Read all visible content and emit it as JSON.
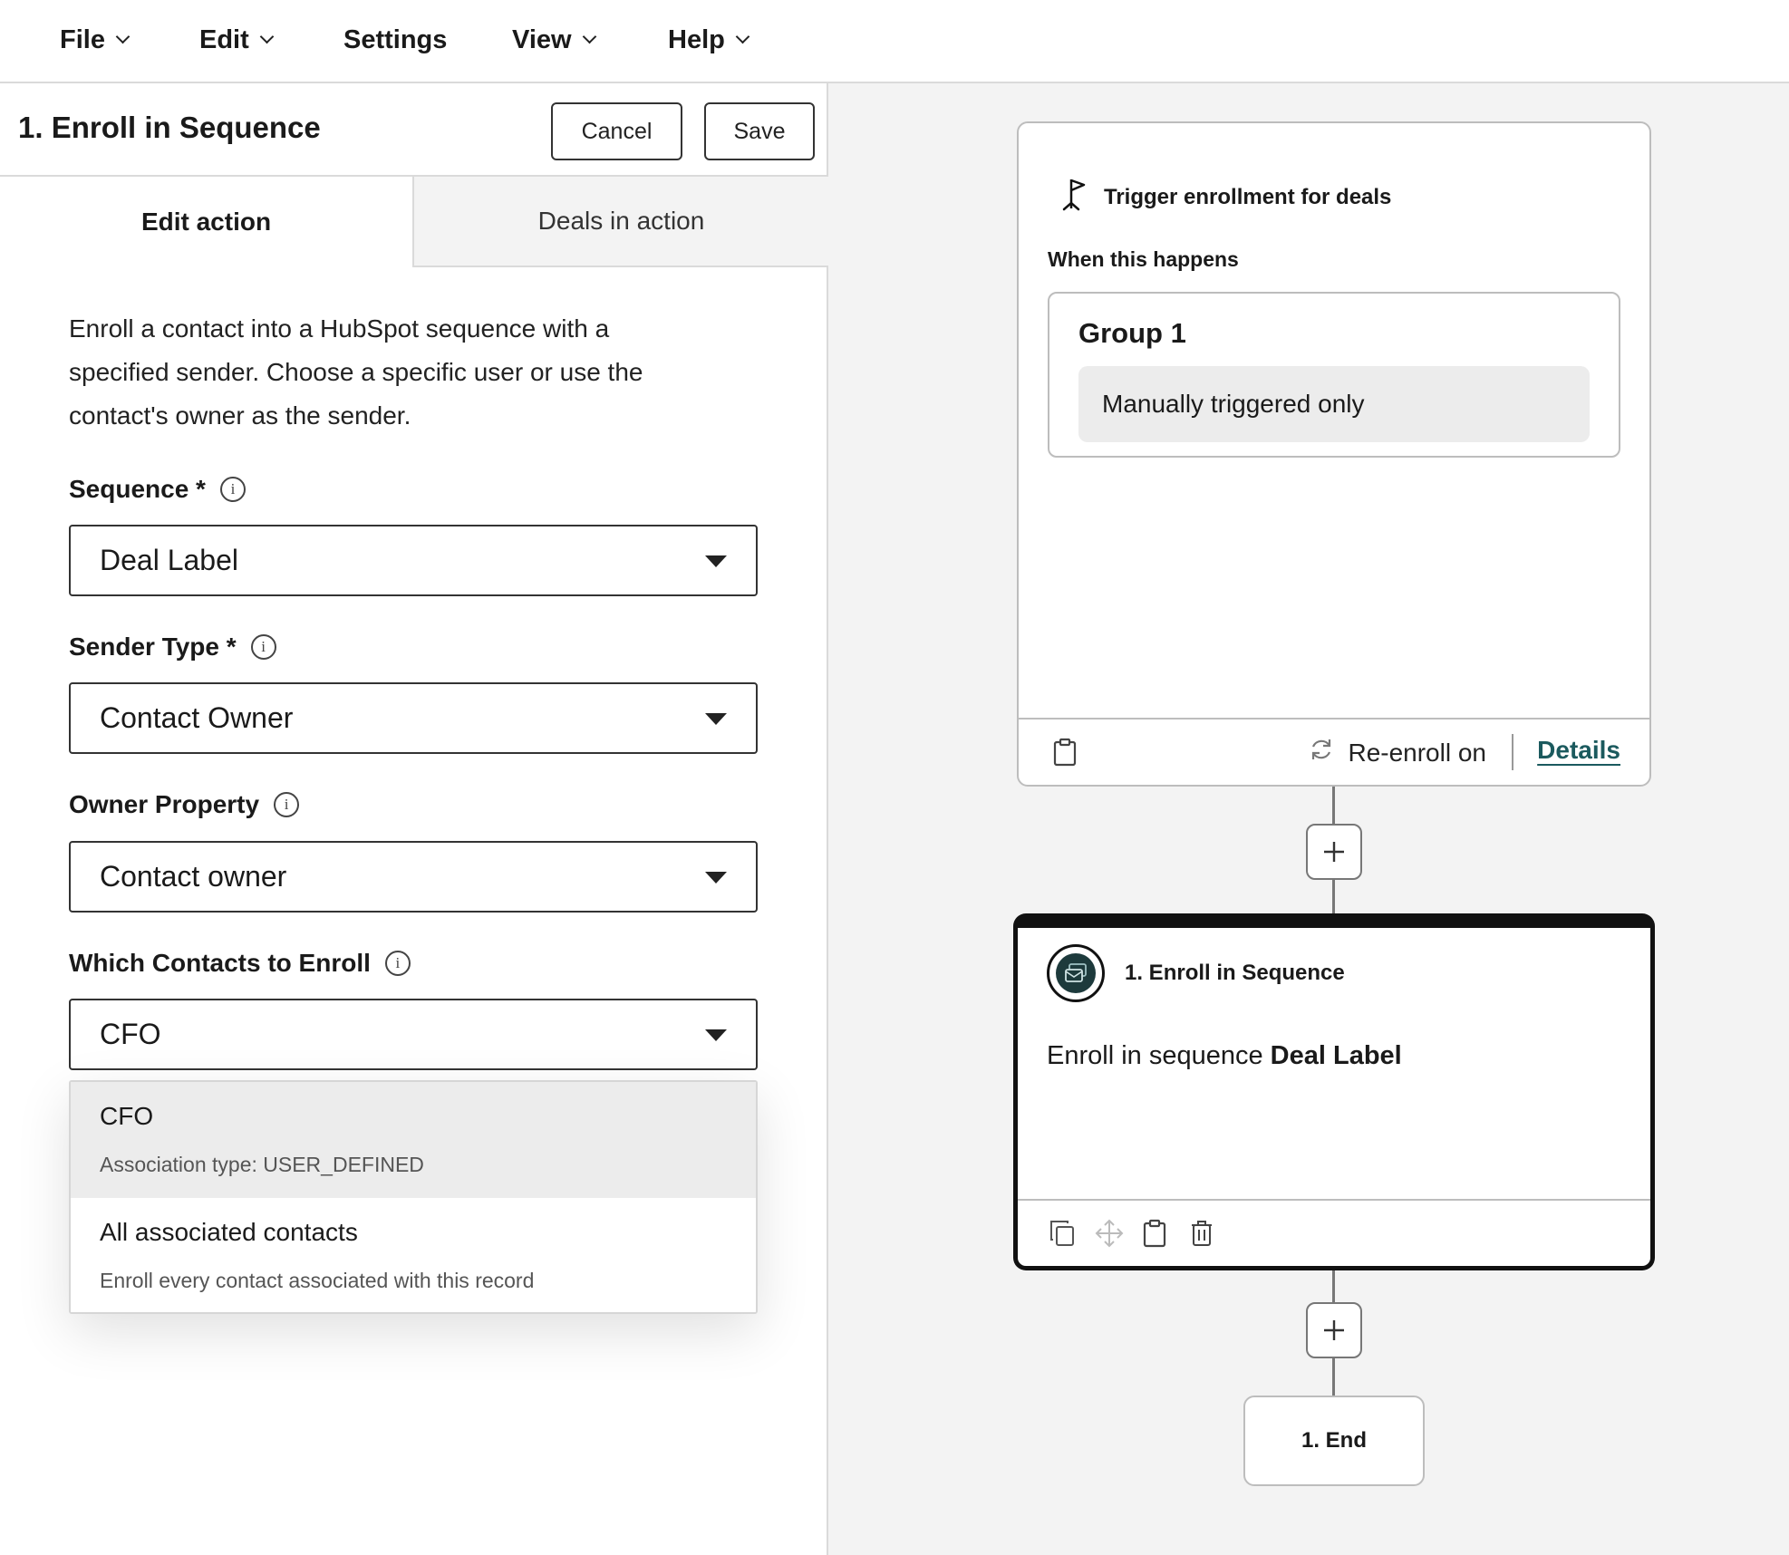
{
  "menu": {
    "items": [
      {
        "label": "File",
        "has_dropdown": true
      },
      {
        "label": "Edit",
        "has_dropdown": true
      },
      {
        "label": "Settings",
        "has_dropdown": false
      },
      {
        "label": "View",
        "has_dropdown": true
      },
      {
        "label": "Help",
        "has_dropdown": true
      }
    ]
  },
  "panel": {
    "title": "1. Enroll in Sequence",
    "cancel_label": "Cancel",
    "save_label": "Save",
    "tabs": [
      {
        "label": "Edit action",
        "active": true
      },
      {
        "label": "Deals in action",
        "active": false
      }
    ],
    "description": "Enroll a contact into a HubSpot sequence with a specified sender. Choose a specific user or use the contact's owner as the sender.",
    "fields": [
      {
        "label": "Sequence *",
        "value": "Deal Label"
      },
      {
        "label": "Sender Type *",
        "value": "Contact Owner"
      },
      {
        "label": "Owner Property",
        "value": "Contact owner"
      },
      {
        "label": "Which Contacts to Enroll",
        "value": "CFO"
      }
    ],
    "dropdown_options": [
      {
        "title": "CFO",
        "subtitle": "Association type: USER_DEFINED",
        "highlighted": true
      },
      {
        "title": "All associated contacts",
        "subtitle": "Enroll every contact associated with this record",
        "highlighted": false
      }
    ]
  },
  "canvas": {
    "trigger": {
      "title": "Trigger enrollment for deals",
      "when_label": "When this happens",
      "group_title": "Group 1",
      "group_condition": "Manually triggered only",
      "reenroll_label": "Re-enroll on",
      "details_label": "Details",
      "icon": "flag-icon"
    },
    "action": {
      "title": "1. Enroll in Sequence",
      "text_prefix": "Enroll in sequence",
      "text_value": "Deal Label",
      "icon": "sequence-icon"
    },
    "end_label": "1. End"
  },
  "colors": {
    "link": "#1b5a5e",
    "action_border": "#111111",
    "canvas_bg": "#f3f3f3"
  }
}
